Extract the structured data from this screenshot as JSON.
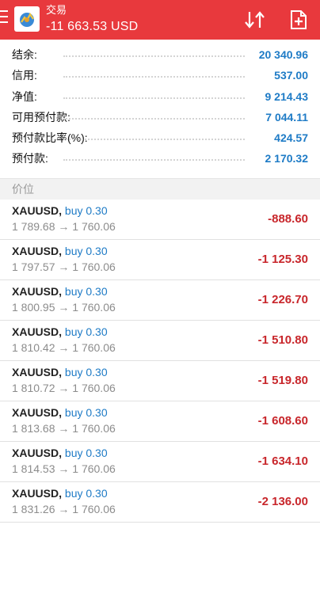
{
  "header": {
    "title": "交易",
    "profit_total": "-11 663.53 USD"
  },
  "account": [
    {
      "label": "结余:",
      "value": "20 340.96"
    },
    {
      "label": "信用:",
      "value": "537.00"
    },
    {
      "label": "净值:",
      "value": "9 214.43"
    },
    {
      "label": "可用预付款:",
      "value": "7 044.11"
    },
    {
      "label": "预付款比率(%):",
      "value": "424.57"
    },
    {
      "label": "预付款:",
      "value": "2 170.32"
    }
  ],
  "section_title": "价位",
  "positions": [
    {
      "symbol": "XAUUSD,",
      "side": "buy 0.30",
      "prices": "1 789.68 → 1 760.06",
      "profit": "-888.60"
    },
    {
      "symbol": "XAUUSD,",
      "side": "buy 0.30",
      "prices": "1 797.57 → 1 760.06",
      "profit": "-1 125.30"
    },
    {
      "symbol": "XAUUSD,",
      "side": "buy 0.30",
      "prices": "1 800.95 → 1 760.06",
      "profit": "-1 226.70"
    },
    {
      "symbol": "XAUUSD,",
      "side": "buy 0.30",
      "prices": "1 810.42 → 1 760.06",
      "profit": "-1 510.80"
    },
    {
      "symbol": "XAUUSD,",
      "side": "buy 0.30",
      "prices": "1 810.72 → 1 760.06",
      "profit": "-1 519.80"
    },
    {
      "symbol": "XAUUSD,",
      "side": "buy 0.30",
      "prices": "1 813.68 → 1 760.06",
      "profit": "-1 608.60"
    },
    {
      "symbol": "XAUUSD,",
      "side": "buy 0.30",
      "prices": "1 814.53 → 1 760.06",
      "profit": "-1 634.10"
    },
    {
      "symbol": "XAUUSD,",
      "side": "buy 0.30",
      "prices": "1 831.26 → 1 760.06",
      "profit": "-2 136.00"
    }
  ],
  "icons": {
    "menu": "menu-icon",
    "logo": "app-logo-icon",
    "sort": "sort-arrows-icon",
    "new_order": "new-order-icon"
  },
  "colors": {
    "header_bg": "#e8393d",
    "value_blue": "#1e7bc6",
    "loss_red": "#c8262b"
  }
}
